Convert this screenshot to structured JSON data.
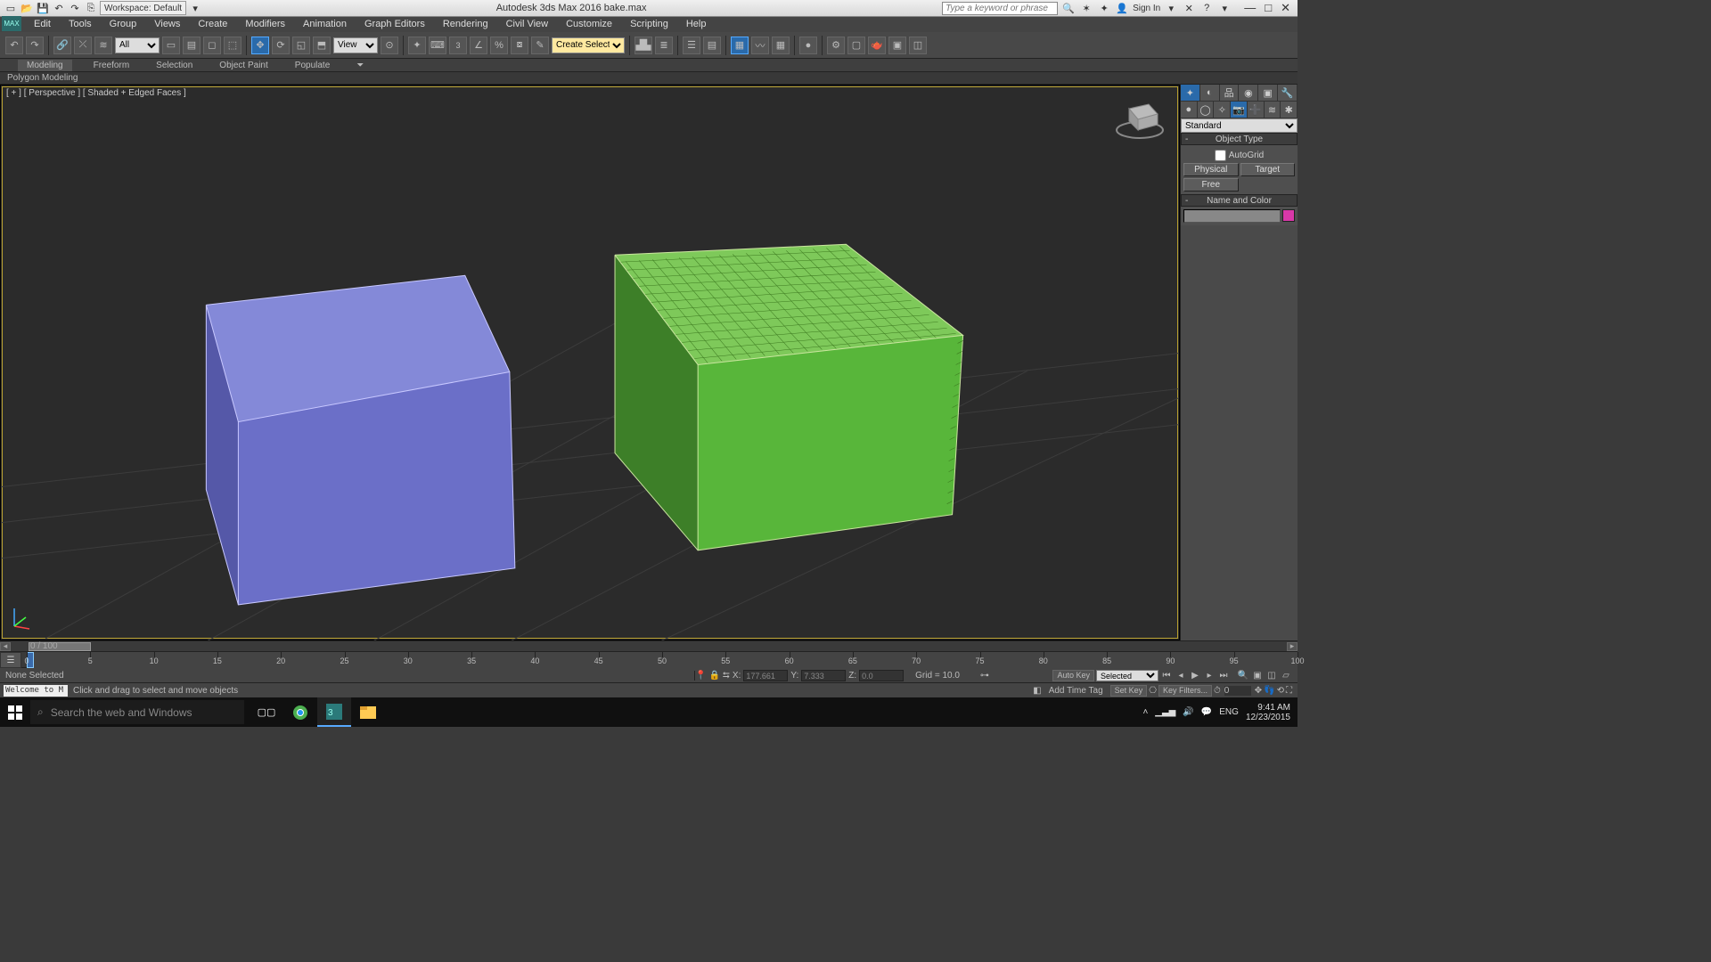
{
  "title": "Autodesk 3ds Max 2016    bake.max",
  "workspace_label": "Workspace: Default",
  "search_placeholder": "Type a keyword or phrase",
  "signin": "Sign In",
  "menus": [
    "Edit",
    "Tools",
    "Group",
    "Views",
    "Create",
    "Modifiers",
    "Animation",
    "Graph Editors",
    "Rendering",
    "Civil View",
    "Customize",
    "Scripting",
    "Help"
  ],
  "toolbar": {
    "all_filter": "All",
    "view_ref": "View",
    "create_sel": "Create Selection Se",
    "num3": "3"
  },
  "ribbon": [
    "Modeling",
    "Freeform",
    "Selection",
    "Object Paint",
    "Populate"
  ],
  "subribbon": "Polygon Modeling",
  "viewport_label": "[ + ] [ Perspective ] [ Shaded + Edged Faces ]",
  "slider_frame": "0 / 100",
  "timeline_ticks": [
    0,
    5,
    10,
    15,
    20,
    25,
    30,
    35,
    40,
    45,
    50,
    55,
    60,
    65,
    70,
    75,
    80,
    85,
    90,
    95,
    100
  ],
  "status": {
    "selection": "None Selected",
    "x_label": "X:",
    "x_val": "177.661",
    "y_label": "Y:",
    "y_val": "7.333",
    "z_label": "Z:",
    "z_val": "0.0",
    "grid": "Grid = 10.0",
    "autokey_label": "Auto Key",
    "setkey_label": "Set Key",
    "autokey_sel": "Selected",
    "keyfilters": "Key Filters...",
    "addtag": "Add Time Tag",
    "welcome": "Welcome to M",
    "hint": "Click and drag to select and move objects"
  },
  "cmd": {
    "primset": "Standard",
    "objtype_hdr": "Object Type",
    "autogrid": "AutoGrid",
    "btns": [
      "Physical",
      "Target",
      "Free"
    ],
    "namecolor_hdr": "Name and Color"
  },
  "taskbar": {
    "search_placeholder": "Search the web and Windows",
    "lang": "ENG",
    "time": "9:41 AM",
    "date": "12/23/2015"
  }
}
